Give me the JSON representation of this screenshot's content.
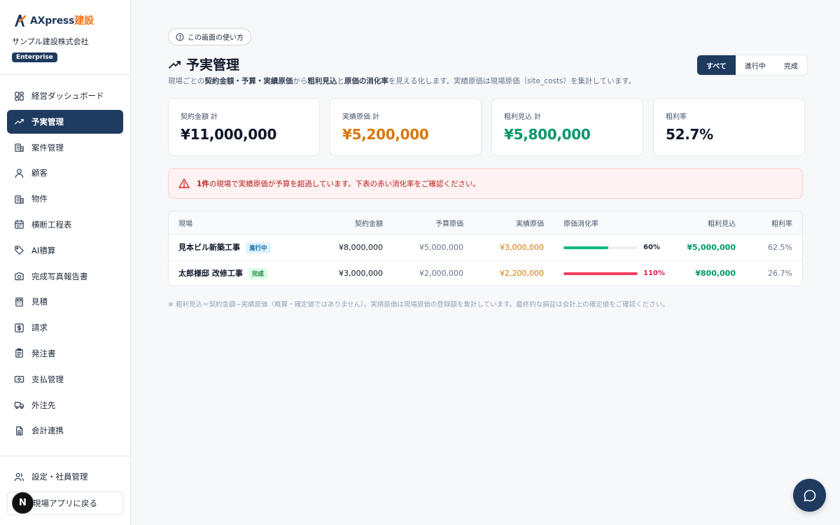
{
  "brand": {
    "name_main": "AXpress",
    "name_accent": "建設",
    "company": "サンプル建設株式会社",
    "plan": "Enterprise"
  },
  "nav": {
    "items": [
      {
        "label": "経営ダッシュボード",
        "icon": "dashboard-icon"
      },
      {
        "label": "予実管理",
        "icon": "trend-icon",
        "active": true
      },
      {
        "label": "案件管理",
        "icon": "building-icon"
      },
      {
        "label": "顧客",
        "icon": "user-icon"
      },
      {
        "label": "物件",
        "icon": "building-icon"
      },
      {
        "label": "横断工程表",
        "icon": "calendar-icon"
      },
      {
        "label": "AI積算",
        "icon": "tag-icon"
      },
      {
        "label": "完成写真報告書",
        "icon": "camera-icon"
      },
      {
        "label": "見積",
        "icon": "calculator-icon"
      },
      {
        "label": "請求",
        "icon": "dollar-icon"
      },
      {
        "label": "発注書",
        "icon": "clipboard-icon"
      },
      {
        "label": "支払管理",
        "icon": "payment-icon"
      },
      {
        "label": "外注先",
        "icon": "truck-icon"
      },
      {
        "label": "会計連携",
        "icon": "spreadsheet-icon"
      }
    ],
    "settings_label": "設定・社員管理",
    "back_label": "現場アプリに戻る",
    "avatar_letter": "N"
  },
  "help_label": "この画面の使い方",
  "page": {
    "title": "予実管理",
    "subtitle_parts": [
      "現場ごとの",
      "契約金額・予算・実績原価",
      "から",
      "粗利見込",
      "と",
      "原価の消化率",
      "を見える化します。実績原価は現場原価（site_costs）を集計しています。"
    ]
  },
  "filter": {
    "all": "すべて",
    "in_progress": "進行中",
    "done": "完成",
    "selected": "all"
  },
  "summary": [
    {
      "label": "契約金額 計",
      "value": "¥11,000,000",
      "color": "#0f172a"
    },
    {
      "label": "実績原価 計",
      "value": "¥5,200,000",
      "color": "#d97706"
    },
    {
      "label": "粗利見込 計",
      "value": "¥5,800,000",
      "color": "#059669"
    },
    {
      "label": "粗利率",
      "value": "52.7%",
      "color": "#0f172a"
    }
  ],
  "alert": {
    "count": "1件",
    "message": "の現場で実績原価が予算を超過しています。下表の赤い消化率をご確認ください。"
  },
  "table": {
    "headers": [
      "現場",
      "契約金額",
      "予算原価",
      "実績原価",
      "原価消化率",
      "粗利見込",
      "粗利率"
    ],
    "rows": [
      {
        "name": "見本ビル新築工事",
        "status": "進行中",
        "status_bg": "#e0f2fe",
        "status_color": "#0369a1",
        "contract": "¥8,000,000",
        "budget": "¥5,000,000",
        "actual": "¥3,000,000",
        "rate": 0.6,
        "rate_label": "60%",
        "bar_color": "#10b981",
        "rate_color": "#1f2937",
        "profit": "¥5,000,000",
        "margin": "62.5%"
      },
      {
        "name": "太郎様邸 改修工事",
        "status": "完成",
        "status_bg": "#dcfce7",
        "status_color": "#15803d",
        "contract": "¥3,000,000",
        "budget": "¥2,000,000",
        "actual": "¥2,200,000",
        "rate": 1.1,
        "rate_label": "110%",
        "bar_color": "#f43f5e",
        "rate_color": "#e11d48",
        "profit": "¥800,000",
        "margin": "26.7%"
      }
    ]
  },
  "footnote": "※ 粗利見込＝契約金額−実績原価（概算・確定値ではありません）。実績原価は現場原価の登録額を集計しています。最終的な損益は会計上の確定値をご確認ください。"
}
